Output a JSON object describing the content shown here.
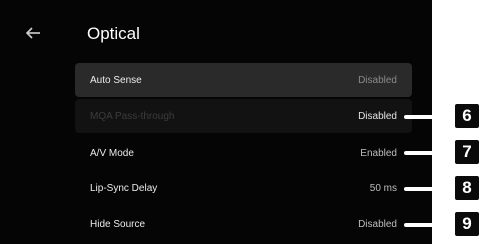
{
  "header": {
    "title": "Optical",
    "back_icon": "arrow-left-icon"
  },
  "settings": [
    {
      "label": "Auto Sense",
      "value": "Disabled",
      "state": "selected"
    },
    {
      "label": "MQA Pass-through",
      "value": "Disabled",
      "state": "disabled"
    },
    {
      "label": "A/V Mode",
      "value": "Enabled",
      "state": "normal"
    },
    {
      "label": "Lip-Sync Delay",
      "value": "50 ms",
      "state": "normal"
    },
    {
      "label": "Hide Source",
      "value": "Disabled",
      "state": "normal"
    }
  ],
  "callouts": [
    "6",
    "7",
    "8",
    "9"
  ],
  "colors": {
    "screen_background": "#050505",
    "selected_row": "#2a2a2a",
    "callout_box": "#0a0a0a"
  }
}
